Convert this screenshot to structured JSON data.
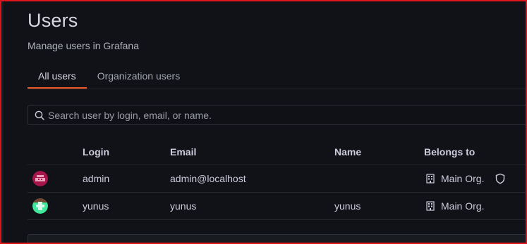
{
  "header": {
    "title": "Users",
    "subtitle": "Manage users in Grafana"
  },
  "tabs": [
    {
      "label": "All users",
      "active": true
    },
    {
      "label": "Organization users",
      "active": false
    }
  ],
  "search": {
    "placeholder": "Search user by login, email, or name.",
    "value": ""
  },
  "table": {
    "columns": [
      "Login",
      "Email",
      "Name",
      "Belongs to"
    ],
    "rows": [
      {
        "login": "admin",
        "email": "admin@localhost",
        "name": "",
        "org": "Main Org.",
        "avatar_color": "#a6164b",
        "is_admin": true
      },
      {
        "login": "yunus",
        "email": "yunus",
        "name": "yunus",
        "org": "Main Org.",
        "avatar_color": "#3fe89a",
        "is_admin": false
      }
    ]
  },
  "colors": {
    "background": "#111217",
    "accent": "#f05a28",
    "frame": "#e0141c"
  },
  "icons": {
    "search": "search-icon",
    "org": "building-icon",
    "admin": "shield-icon"
  }
}
